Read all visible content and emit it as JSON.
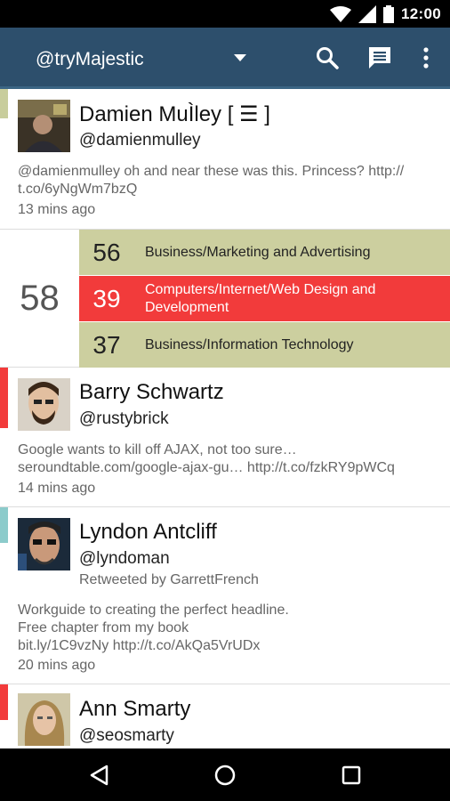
{
  "status_bar": {
    "time": "12:00",
    "icons": [
      "wifi-icon",
      "signal-icon",
      "battery-icon"
    ]
  },
  "app_bar": {
    "account": "@tryMajestic",
    "actions": [
      "search-icon",
      "compose-message-icon",
      "overflow-menu-icon"
    ],
    "color": "#2d4f6c"
  },
  "feed": {
    "tweets": [
      {
        "name": "Damien MuÌley [ ☰ ]",
        "handle": "@damienmulley",
        "retweeted_by": "",
        "text_lines": [
          "@damienmulley oh and near these was this. Princess? http://",
          "t.co/6yNgWm7bzQ"
        ],
        "time": "13 mins ago",
        "bar_color": "#c8cd9c"
      },
      {
        "name": "Barry Schwartz",
        "handle": "@rustybrick",
        "retweeted_by": "",
        "text_lines": [
          "Google wants to kill off AJAX, not too sure…",
          "seroundtable.com/google-ajax-gu… http://t.co/fzkRY9pWCq"
        ],
        "time": "14 mins ago",
        "bar_color": "#f23b3b"
      },
      {
        "name": "Lyndon Antcliff",
        "handle": "@lyndoman",
        "retweeted_by": "Retweeted by GarrettFrench",
        "text_lines": [
          "Workguide to creating the perfect headline.",
          "Free chapter from my book",
          "bit.ly/1C9vzNy http://t.co/AkQa5VrUDx"
        ],
        "time": "20 mins ago",
        "bar_color": "#8ccbcb"
      },
      {
        "name": "Ann Smarty",
        "handle": "@seosmarty",
        "retweeted_by": "",
        "text_lines": [],
        "time": "",
        "bar_color": "#f23b3b"
      }
    ],
    "classification": {
      "total": "58",
      "rows": [
        {
          "score": "56",
          "label_lines": [
            "Business/Marketing and Advertising"
          ],
          "bg": "#cccf9f",
          "fg": "#222222"
        },
        {
          "score": "39",
          "label_lines": [
            "Computers/Internet/Web Design and",
            "Development"
          ],
          "bg": "#f23b3b",
          "fg": "#ffffff"
        },
        {
          "score": "37",
          "label_lines": [
            "Business/Information Technology"
          ],
          "bg": "#cccf9f",
          "fg": "#222222"
        }
      ]
    }
  },
  "nav_bar": {
    "buttons": [
      "back-icon",
      "home-icon",
      "recents-icon"
    ]
  }
}
